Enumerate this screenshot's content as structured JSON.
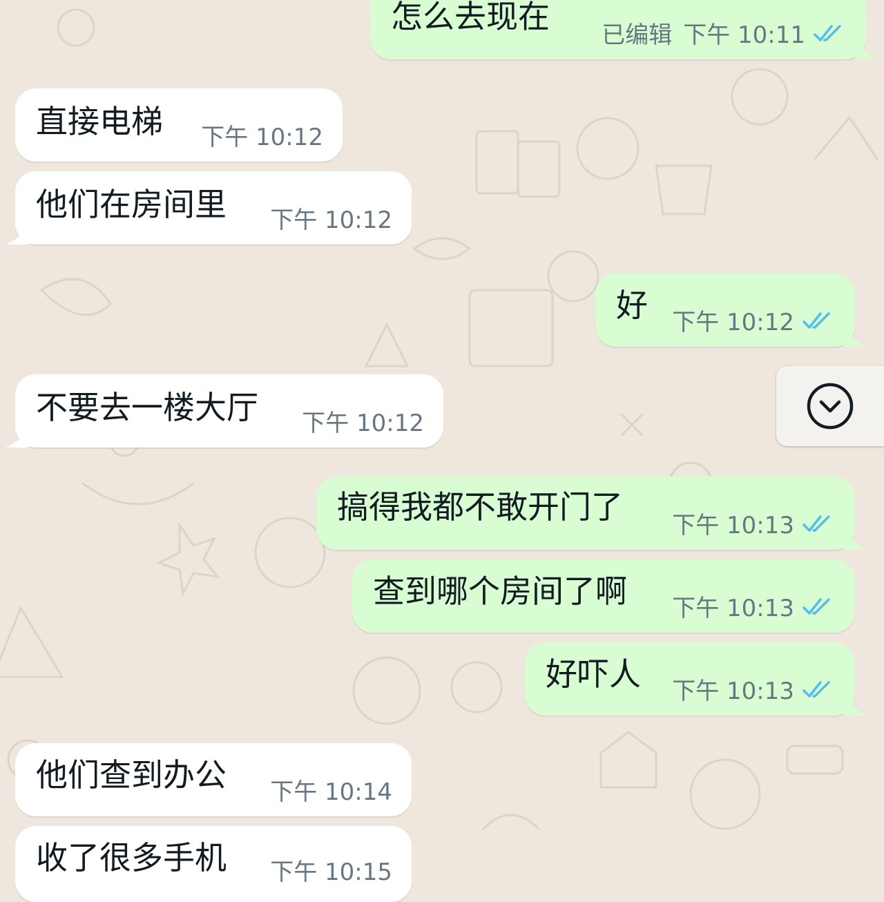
{
  "chat": {
    "messages": [
      {
        "dir": "out",
        "text": "怎么去现在",
        "edited": "已编辑",
        "time": "下午 10:11",
        "status": "read"
      },
      {
        "dir": "in",
        "text": "直接电梯",
        "time": "下午 10:12"
      },
      {
        "dir": "in",
        "text": "他们在房间里",
        "time": "下午 10:12"
      },
      {
        "dir": "out",
        "text": "好",
        "time": "下午 10:12",
        "status": "read"
      },
      {
        "dir": "in",
        "text": "不要去一楼大厅",
        "time": "下午 10:12"
      },
      {
        "dir": "out",
        "text": "搞得我都不敢开门了",
        "time": "下午 10:13",
        "status": "read"
      },
      {
        "dir": "out",
        "text": "查到哪个房间了啊",
        "time": "下午 10:13",
        "status": "read"
      },
      {
        "dir": "out",
        "text": "好吓人",
        "time": "下午 10:13",
        "status": "read"
      },
      {
        "dir": "in",
        "text": "他们查到办公",
        "time": "下午 10:14"
      },
      {
        "dir": "in",
        "text": "收了很多手机",
        "time": "下午 10:15"
      }
    ],
    "scroll_button_icon": "chevron-down-circle-icon",
    "colors": {
      "background": "#efe7de",
      "incoming_bubble": "#ffffff",
      "outgoing_bubble": "#d9fdd3",
      "read_ticks": "#53bdeb",
      "meta_text": "#667781"
    }
  }
}
